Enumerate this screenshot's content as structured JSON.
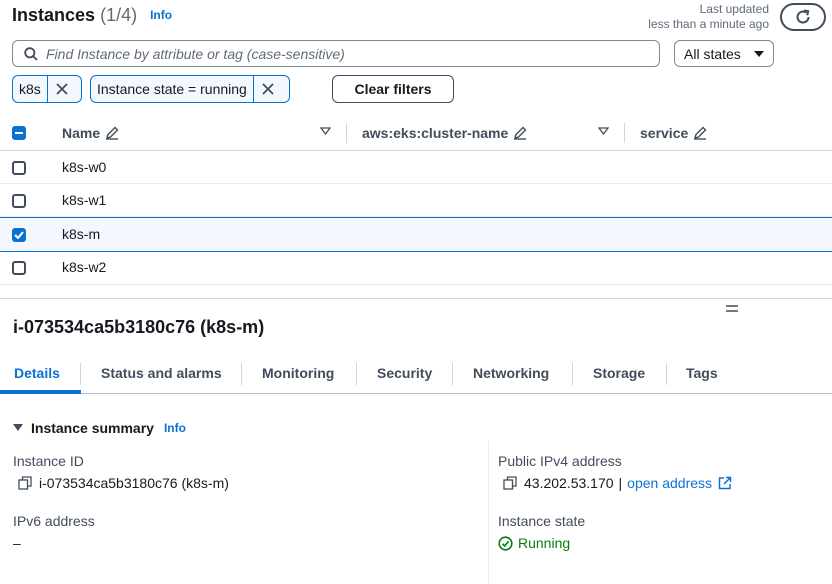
{
  "header": {
    "title": "Instances",
    "count": "(1/4)",
    "info": "Info",
    "last_updated_label": "Last updated",
    "last_updated_value": "less than a minute ago"
  },
  "search": {
    "placeholder": "Find Instance by attribute or tag (case-sensitive)"
  },
  "state_filter": {
    "selected": "All states"
  },
  "filters": {
    "tokens": [
      "k8s",
      "Instance state = running"
    ],
    "clear_label": "Clear filters"
  },
  "table": {
    "columns": [
      "Name",
      "aws:eks:cluster-name",
      "service"
    ],
    "rows": [
      {
        "name": "k8s-w0",
        "checked": false
      },
      {
        "name": "k8s-w1",
        "checked": false
      },
      {
        "name": "k8s-m",
        "checked": true
      },
      {
        "name": "k8s-w2",
        "checked": false
      }
    ]
  },
  "detail": {
    "title": "i-073534ca5b3180c76 (k8s-m)",
    "tabs": [
      "Details",
      "Status and alarms",
      "Monitoring",
      "Security",
      "Networking",
      "Storage",
      "Tags"
    ],
    "active_tab": "Details",
    "summary_title": "Instance summary",
    "summary_info": "Info",
    "fields": {
      "instance_id_label": "Instance ID",
      "instance_id_value": "i-073534ca5b3180c76 (k8s-m)",
      "public_ipv4_label": "Public IPv4 address",
      "public_ipv4_value": "43.202.53.170",
      "public_ipv4_sep": "|",
      "open_address": "open address",
      "ipv6_label": "IPv6 address",
      "ipv6_value": "–",
      "state_label": "Instance state",
      "state_value": "Running"
    }
  },
  "colors": {
    "link": "#0972d3",
    "success": "#037f0c",
    "text": "#16191f"
  }
}
